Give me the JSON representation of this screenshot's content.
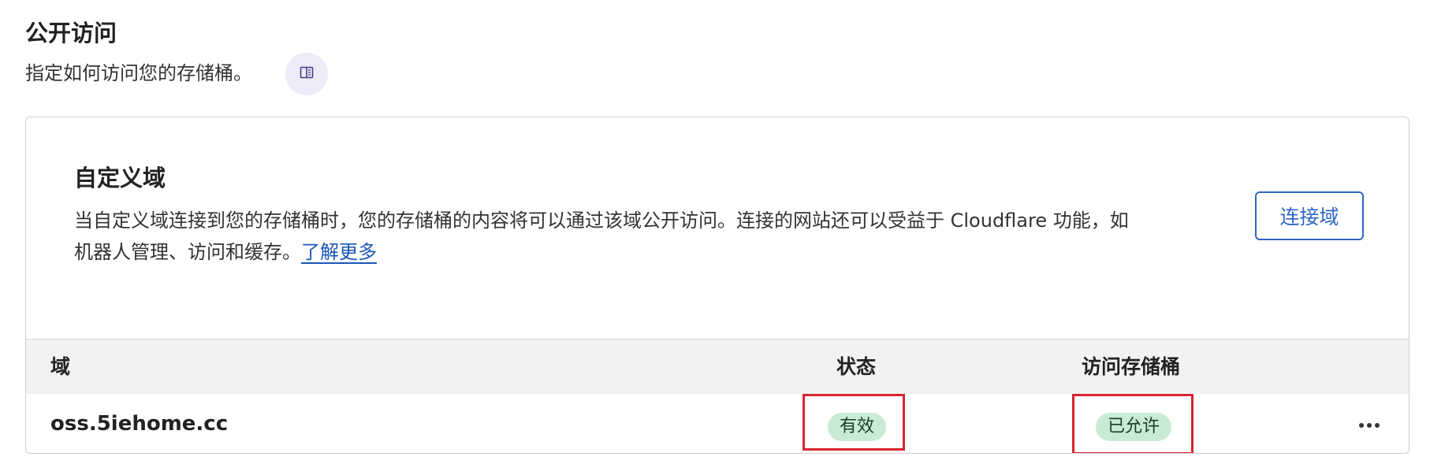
{
  "public_access": {
    "title": "公开访问",
    "description": "指定如何访问您的存储桶。",
    "doc_icon": "book-icon"
  },
  "custom_domain": {
    "title": "自定义域",
    "description_line1": "当自定义域连接到您的存储桶时，您的存储桶的内容将可以通过该域公开访问。连接的网站还可以受益于 Cloudflare 功能，如",
    "description_line2": "机器人管理、访问和缓存。",
    "learn_more": "了解更多",
    "connect_button": "连接域"
  },
  "table": {
    "headers": {
      "domain": "域",
      "status": "状态",
      "access": "访问存储桶"
    },
    "rows": [
      {
        "domain": "oss.5iehome.cc",
        "status": "有效",
        "access": "已允许",
        "more_icon": "more-options-icon"
      }
    ]
  },
  "colors": {
    "accent": "#2f67c4",
    "badge_bg": "#c9ebd3",
    "highlight": "#d9242f"
  }
}
